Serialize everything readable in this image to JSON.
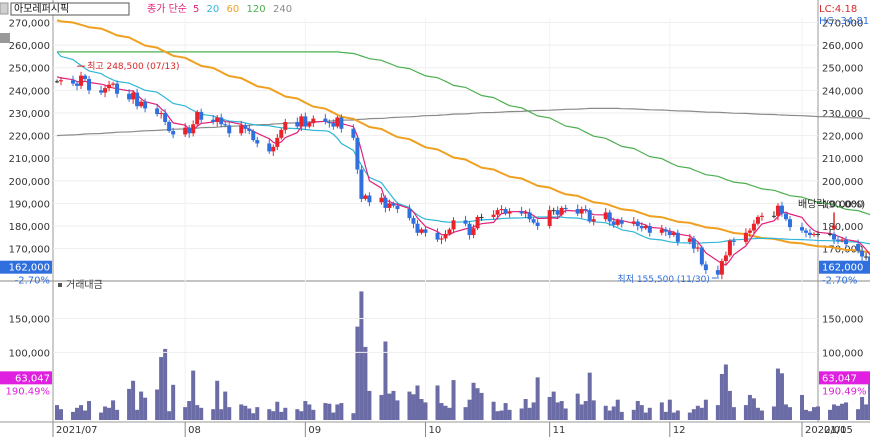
{
  "header": {
    "stock_name": "아모레퍼시픽",
    "legend_prefix": "종가 단순",
    "ma_legend": [
      {
        "label": "5",
        "color": "#e0207a"
      },
      {
        "label": "20",
        "color": "#2fb6d8"
      },
      {
        "label": "60",
        "color": "#f0a020"
      },
      {
        "label": "120",
        "color": "#4caf50"
      },
      {
        "label": "240",
        "color": "#8a8a8a"
      }
    ],
    "lc": "LC:4.18",
    "hc": "HC:-34.81"
  },
  "price_axis": {
    "ticks": [
      "270,000",
      "260,000",
      "250,000",
      "240,000",
      "230,000",
      "220,000",
      "210,000",
      "200,000",
      "190,000",
      "180,000",
      "170,000"
    ],
    "current": "162,000",
    "change": "-2.70%"
  },
  "volume_panel": {
    "title": "거래대금",
    "ticks": [
      "150,000",
      "100,000"
    ],
    "current": "63,047",
    "ratio": "190.49%"
  },
  "annotations": {
    "high": "최고 248,500 (07/13)",
    "low": "최저 155,500 (11/30)",
    "dividend": "배당락(0.00%)"
  },
  "x_axis": {
    "labels": [
      "2021/07",
      "08",
      "09",
      "10",
      "11",
      "12",
      "2022/01",
      "01/05"
    ]
  },
  "chart_data": {
    "type": "candlestick",
    "title": "아모레퍼시픽",
    "y_range": [
      157000,
      272000
    ],
    "volume_range": [
      0,
      198000
    ],
    "start_date": "2021-07-01",
    "end_date": "2022-01-05",
    "closes": [
      244000,
      244500,
      243000,
      242000,
      246500,
      245000,
      240000,
      239000,
      241000,
      242500,
      243000,
      238500,
      236000,
      239000,
      233000,
      235000,
      232000,
      229500,
      230000,
      226000,
      222000,
      220500,
      223500,
      221000,
      225000,
      230500,
      227000,
      226000,
      228000,
      225000,
      224500,
      221000,
      224500,
      223000,
      222000,
      218000,
      216500,
      213000,
      215000,
      219000,
      222500,
      226000,
      224000,
      228500,
      224000,
      225500,
      227500,
      226000,
      225500,
      224000,
      228000,
      223000,
      219000,
      205000,
      192000,
      193500,
      190500,
      192500,
      188000,
      190000,
      189000,
      187500,
      183500,
      181000,
      177000,
      178500,
      177000,
      174000,
      174500,
      176500,
      178500,
      182500,
      181000,
      176000,
      179000,
      184000,
      184000,
      185000,
      187000,
      187500,
      185500,
      186500,
      185500,
      186000,
      183000,
      181500,
      180000,
      187000,
      187000,
      185000,
      188000,
      187500,
      185500,
      187500,
      187000,
      182000,
      183000,
      186000,
      182000,
      180500,
      182500,
      181000,
      182000,
      180000,
      179000,
      180000,
      177000,
      178500,
      177500,
      176000,
      177000,
      173000,
      174500,
      170000,
      170500,
      163000,
      160500,
      158500,
      164500,
      167000,
      173500,
      173000,
      177000,
      178000,
      181000,
      184000,
      184500,
      184500,
      189000,
      185500,
      183000,
      179500,
      178000,
      177000,
      176000,
      176500,
      176500,
      176500,
      174000,
      173500,
      174000,
      172000,
      169000,
      166500,
      166500,
      162000
    ],
    "opens": [
      244000,
      244000,
      244500,
      243000,
      242000,
      246500,
      245000,
      240000,
      239000,
      241000,
      242500,
      243000,
      238500,
      236000,
      239000,
      233000,
      235000,
      232000,
      229500,
      230000,
      226000,
      222000,
      220500,
      223500,
      221000,
      225000,
      230500,
      227000,
      226000,
      228000,
      225000,
      224500,
      221000,
      224500,
      223000,
      222000,
      218000,
      216500,
      213000,
      215000,
      219000,
      222500,
      226000,
      224000,
      228500,
      224000,
      225500,
      227500,
      226000,
      225500,
      224000,
      228000,
      223000,
      219000,
      205000,
      192000,
      193500,
      190500,
      192500,
      188000,
      190000,
      189000,
      187500,
      183500,
      181000,
      177000,
      178500,
      177000,
      174000,
      174500,
      176500,
      178500,
      182500,
      181000,
      176000,
      179000,
      184000,
      184000,
      185000,
      187000,
      187500,
      185500,
      186500,
      185500,
      186000,
      183000,
      181500,
      180000,
      187000,
      187000,
      185000,
      188000,
      187500,
      185500,
      187500,
      187000,
      182000,
      183000,
      186000,
      182000,
      180500,
      182500,
      181000,
      182000,
      180000,
      179000,
      180000,
      177000,
      178500,
      177500,
      176000,
      177000,
      173000,
      174500,
      170000,
      170500,
      163000,
      160500,
      158500,
      164500,
      167000,
      173500,
      173000,
      177000,
      178000,
      181000,
      184000,
      184500,
      184500,
      189000,
      185500,
      183000,
      179500,
      178000,
      177000,
      176000,
      176500,
      176500,
      176500,
      174000,
      173500,
      174000,
      172000,
      169000,
      166500,
      166500
    ],
    "volumes": [
      22000,
      16000,
      12000,
      18000,
      22000,
      14000,
      28000,
      11000,
      20000,
      18000,
      29000,
      15000,
      46000,
      58000,
      15000,
      42000,
      33000,
      45000,
      93000,
      105000,
      13000,
      52000,
      19000,
      28000,
      73000,
      22000,
      18000,
      16000,
      58000,
      16000,
      42000,
      19000,
      23000,
      21000,
      17000,
      10000,
      19000,
      16000,
      13000,
      27000,
      12000,
      18000,
      16000,
      13000,
      28000,
      23000,
      15000,
      25000,
      24000,
      11000,
      23000,
      25000,
      10000,
      138000,
      190000,
      108000,
      43000,
      37000,
      116000,
      39000,
      43000,
      29000,
      42000,
      38000,
      51000,
      31000,
      26000,
      51000,
      25000,
      21000,
      18000,
      59000,
      19000,
      30000,
      55000,
      47000,
      40000,
      27000,
      13000,
      14000,
      25000,
      15000,
      17000,
      31000,
      18000,
      26000,
      63000,
      34000,
      42000,
      26000,
      28000,
      17000,
      39000,
      23000,
      28000,
      70000,
      29000,
      21000,
      14000,
      20000,
      30000,
      12000,
      15000,
      28000,
      22000,
      11000,
      18000,
      26000,
      12000,
      30000,
      11000,
      14000,
      11000,
      16000,
      21000,
      18000,
      30000,
      22000,
      68000,
      82000,
      43000,
      19000,
      22000,
      37000,
      32000,
      18000,
      14000,
      20000,
      76000,
      69000,
      23000,
      19000,
      37000,
      15000,
      13000,
      19000,
      20000,
      15000,
      23000,
      21000,
      24000,
      26000,
      16000,
      34000,
      23000,
      63047
    ],
    "ma5": [
      246000,
      245500,
      244700,
      243900,
      243500,
      244000,
      243500,
      242700,
      242300,
      241500,
      241100,
      240700,
      239800,
      239800,
      237900,
      236300,
      235000,
      233700,
      231900,
      230500,
      228000,
      225600,
      224600,
      222800,
      222400,
      224100,
      225400,
      226000,
      227300,
      227300,
      226100,
      226100,
      225000,
      223600,
      222900,
      221900,
      221000,
      218600,
      217000,
      216300,
      217200,
      219100,
      221300,
      224000,
      225000,
      225600,
      225900,
      226300,
      225700,
      225700,
      226200,
      225300,
      223900,
      219800,
      213400,
      206500,
      200000,
      196700,
      191300,
      190900,
      190000,
      189500,
      187700,
      186200,
      183600,
      181700,
      179800,
      177500,
      176200,
      176100,
      176100,
      177200,
      178700,
      179000,
      179600,
      180500,
      181000,
      181600,
      183800,
      185500,
      185700,
      186300,
      186400,
      186300,
      185700,
      184600,
      183300,
      183500,
      183600,
      183300,
      185400,
      186900,
      186600,
      186700,
      187100,
      185900,
      185000,
      184900,
      184000,
      182700,
      182800,
      182400,
      181200,
      181200,
      181000,
      180400,
      179400,
      179000,
      178000,
      177800,
      177200,
      176400,
      175600,
      174100,
      173000,
      170600,
      168100,
      164500,
      163400,
      162700,
      164800,
      167400,
      171200,
      173700,
      176500,
      178700,
      180900,
      182300,
      184100,
      185700,
      186100,
      185300,
      183800,
      181400,
      179500,
      178000,
      177200,
      176700,
      176200,
      175500,
      174900,
      174000,
      173100,
      171500,
      169600,
      167200
    ],
    "ma20": [
      257000,
      255000,
      253600,
      252300,
      251000,
      249800,
      248600,
      247400,
      246300,
      245400,
      244600,
      243900,
      243200,
      242400,
      241600,
      240800,
      240000,
      239200,
      238000,
      236800,
      235500,
      234200,
      233100,
      232000,
      231100,
      230200,
      229400,
      228700,
      228000,
      227400,
      226900,
      226400,
      226000,
      225600,
      225200,
      224900,
      224600,
      224300,
      224000,
      223700,
      223500,
      223300,
      223100,
      222900,
      222700,
      222500,
      222300,
      222100,
      221700,
      220500,
      218800,
      216500,
      213500,
      210000,
      207000,
      204000,
      201500,
      199200,
      196800,
      194500,
      192200,
      190100,
      188200,
      186300,
      184900,
      183800,
      183000,
      182400,
      182000,
      181800,
      181700,
      181700,
      181800,
      182000,
      182200,
      182500,
      182700,
      182900,
      183100,
      183300,
      183400,
      183500,
      183600,
      183700,
      183800,
      183900,
      184000,
      184000,
      184000,
      184000,
      183900,
      183700,
      183500,
      183200,
      182800,
      182400,
      181900,
      181400,
      180800,
      180000,
      179200,
      178300,
      177400,
      176500,
      175700,
      174900,
      174300,
      173800,
      173400,
      173000,
      172800,
      172600,
      172500,
      172400,
      172400,
      172500,
      172600,
      172800,
      173000,
      173300,
      173600,
      173900,
      174100,
      174300,
      174400,
      174500,
      174500,
      174500,
      174400,
      174300,
      174200,
      174100,
      174000,
      173900,
      173800,
      173700,
      173600,
      173500,
      173400,
      173300,
      173200,
      173100,
      172900,
      172700,
      172400,
      172100
    ],
    "ma60": [
      271000,
      270500,
      270000,
      269500,
      269000,
      268500,
      267900,
      267300,
      266600,
      265900,
      265100,
      264300,
      263400,
      262500,
      261600,
      260700,
      259800,
      258900,
      258000,
      257100,
      256200,
      255300,
      254400,
      253500,
      252600,
      251700,
      250800,
      249900,
      249000,
      248100,
      247200,
      246300,
      245400,
      244500,
      243600,
      242700,
      241800,
      240900,
      240000,
      239100,
      238200,
      237300,
      236400,
      235500,
      234600,
      233700,
      232800,
      231900,
      231000,
      230100,
      229200,
      228300,
      227400,
      226500,
      225600,
      224700,
      223800,
      222900,
      222000,
      221100,
      220200,
      219300,
      218400,
      217500,
      216600,
      215700,
      214800,
      213900,
      213000,
      212100,
      211200,
      210300,
      209400,
      208500,
      207600,
      206700,
      205800,
      205000,
      204200,
      203400,
      202600,
      201800,
      201000,
      200200,
      199400,
      198600,
      197800,
      197000,
      196200,
      195400,
      194700,
      194000,
      193300,
      192600,
      191900,
      191200,
      190500,
      189800,
      189200,
      188600,
      188000,
      187400,
      186800,
      186200,
      185600,
      185000,
      184400,
      183900,
      183400,
      182900,
      182400,
      181900,
      181400,
      180900,
      180400,
      179900,
      179400,
      178900,
      178400,
      177900,
      177400,
      176900,
      176400,
      175900,
      175500,
      175100,
      174700,
      174300,
      173900,
      173500,
      173100,
      172700,
      172300,
      171900,
      171600,
      171300,
      171000,
      170700,
      170400,
      170100,
      169800,
      169500,
      169200,
      168900,
      168600,
      168300
    ],
    "ma120": [
      257000,
      257000,
      257000,
      257000,
      257000,
      257000,
      257000,
      257000,
      257000,
      257000,
      257000,
      257000,
      257000,
      257000,
      257000,
      257000,
      257000,
      257000,
      257000,
      257000,
      257000,
      257000,
      257000,
      257000,
      257000,
      257000,
      257000,
      257000,
      257000,
      257000,
      257000,
      257000,
      257000,
      257000,
      257000,
      257000,
      257000,
      257000,
      257000,
      257000,
      257000,
      257000,
      257000,
      257000,
      257000,
      257000,
      257000,
      257000,
      257000,
      257000,
      257000,
      256800,
      256300,
      255800,
      255200,
      254600,
      254000,
      253300,
      252600,
      251900,
      251200,
      250400,
      249600,
      248800,
      248000,
      247200,
      246400,
      245600,
      244800,
      244000,
      243100,
      242200,
      241300,
      240400,
      239500,
      238600,
      237700,
      236800,
      235900,
      235000,
      234100,
      233200,
      232300,
      231400,
      230500,
      229600,
      228700,
      227800,
      226900,
      226000,
      225100,
      224200,
      223300,
      222400,
      221500,
      220600,
      219700,
      218800,
      217900,
      217000,
      216100,
      215200,
      214300,
      213400,
      212500,
      211600,
      210700,
      209800,
      208900,
      208000,
      207200,
      206400,
      205600,
      204800,
      204100,
      203400,
      202700,
      202000,
      201300,
      200600,
      200000,
      199400,
      198800,
      198200,
      197600,
      197000,
      196400,
      195800,
      195200,
      194600,
      194000,
      193400,
      192800,
      192200,
      191600,
      191000,
      190400,
      189800,
      189200,
      188600,
      188000,
      187400,
      186800,
      186200,
      185600,
      185000
    ],
    "ma240": [
      220000,
      220100,
      220300,
      220400,
      220500,
      220700,
      220800,
      220900,
      221100,
      221200,
      221300,
      221500,
      221600,
      221700,
      221900,
      222000,
      222100,
      222300,
      222400,
      222500,
      222700,
      222800,
      222900,
      223100,
      223200,
      223300,
      223500,
      223600,
      223700,
      223900,
      224000,
      224100,
      224300,
      224400,
      224500,
      224700,
      224800,
      224900,
      225100,
      225200,
      225300,
      225500,
      225600,
      225700,
      225900,
      226000,
      226100,
      226300,
      226400,
      226500,
      226700,
      226800,
      226900,
      227100,
      227200,
      227300,
      227500,
      227600,
      227700,
      227900,
      228000,
      228100,
      228300,
      228400,
      228500,
      228700,
      228800,
      228900,
      229100,
      229200,
      229300,
      229500,
      229600,
      229700,
      229900,
      230000,
      230100,
      230200,
      230300,
      230400,
      230500,
      230600,
      230700,
      230800,
      230900,
      231000,
      231100,
      231200,
      231300,
      231400,
      231500,
      231600,
      231700,
      231800,
      231900,
      232000,
      232000,
      232000,
      232000,
      232000,
      232000,
      231900,
      231800,
      231700,
      231600,
      231500,
      231400,
      231300,
      231200,
      231100,
      231000,
      230900,
      230800,
      230700,
      230600,
      230500,
      230400,
      230300,
      230200,
      230100,
      230000,
      229900,
      229800,
      229700,
      229600,
      229500,
      229400,
      229300,
      229200,
      229100,
      229000,
      228900,
      228800,
      228700,
      228600,
      228500,
      228400,
      228300,
      228200,
      228100,
      228000,
      227900,
      227800,
      227700,
      227600,
      227500
    ]
  }
}
